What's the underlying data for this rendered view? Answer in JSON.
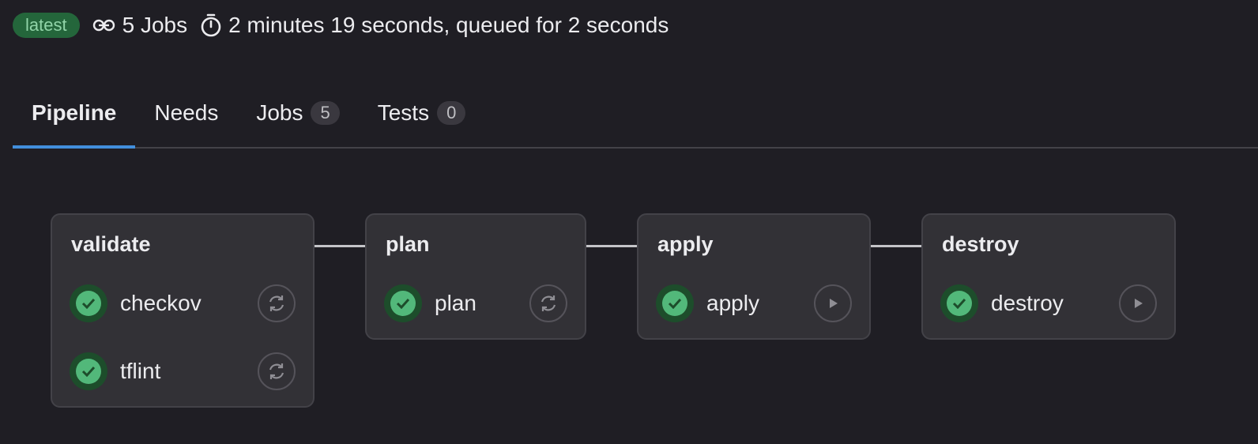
{
  "meta": {
    "badge": "latest",
    "jobs_count": "5 Jobs",
    "duration": "2 minutes 19 seconds, queued for 2 seconds"
  },
  "tabs": [
    {
      "label": "Pipeline",
      "count": null
    },
    {
      "label": "Needs",
      "count": null
    },
    {
      "label": "Jobs",
      "count": "5"
    },
    {
      "label": "Tests",
      "count": "0"
    }
  ],
  "stages": [
    {
      "name": "validate",
      "jobs": [
        {
          "name": "checkov",
          "status": "passed",
          "action": "retry-icon"
        },
        {
          "name": "tflint",
          "status": "passed",
          "action": "retry-icon"
        }
      ]
    },
    {
      "name": "plan",
      "jobs": [
        {
          "name": "plan",
          "status": "passed",
          "action": "retry-icon"
        }
      ]
    },
    {
      "name": "apply",
      "jobs": [
        {
          "name": "apply",
          "status": "passed",
          "action": "play-icon"
        }
      ]
    },
    {
      "name": "destroy",
      "jobs": [
        {
          "name": "destroy",
          "status": "passed",
          "action": "play-icon"
        }
      ]
    }
  ],
  "colors": {
    "success": "#52b87a",
    "active_tab": "#428fdc",
    "badge_bg": "#24663b"
  }
}
